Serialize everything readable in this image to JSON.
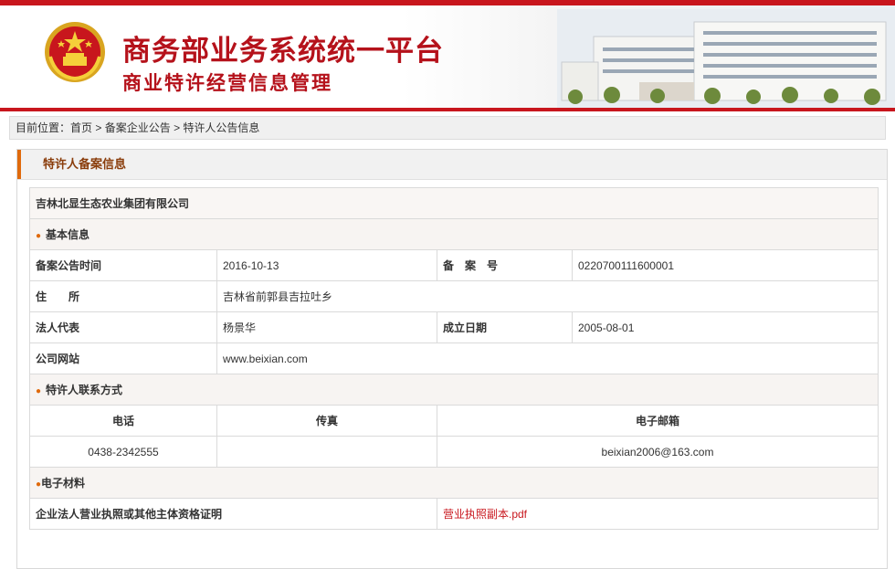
{
  "header": {
    "title": "商务部业务系统统一平台",
    "subtitle": "商业特许经营信息管理"
  },
  "breadcrumb": {
    "prefix": "目前位置：",
    "home": "首页",
    "separator": " > ",
    "level2": "备案企业公告",
    "level3": "特许人公告信息"
  },
  "panel": {
    "title": "特许人备案信息"
  },
  "company": {
    "name": "吉林北显生态农业集团有限公司"
  },
  "basic": {
    "section_title": "基本信息",
    "announce_time_label": "备案公告时间",
    "announce_time": "2016-10-13",
    "record_no_label": "备　案　号",
    "record_no": "0220700111600001",
    "address_label": "住　　所",
    "address": "吉林省前郭县吉拉吐乡",
    "legal_rep_label": "法人代表",
    "legal_rep": "杨景华",
    "founded_label": "成立日期",
    "founded": "2005-08-01",
    "website_label": "公司网站",
    "website": "www.beixian.com"
  },
  "contact": {
    "section_title": "特许人联系方式",
    "phone_header": "电话",
    "fax_header": "传真",
    "email_header": "电子邮箱",
    "phone": "0438-2342555",
    "fax": "",
    "email": "beixian2006@163.com"
  },
  "materials": {
    "section_title": "电子材料",
    "license_label": "企业法人营业执照或其他主体资格证明",
    "license_file": "营业执照副本.pdf"
  },
  "colors": {
    "brand_red": "#c8161d",
    "accent_orange": "#e06a0c"
  }
}
